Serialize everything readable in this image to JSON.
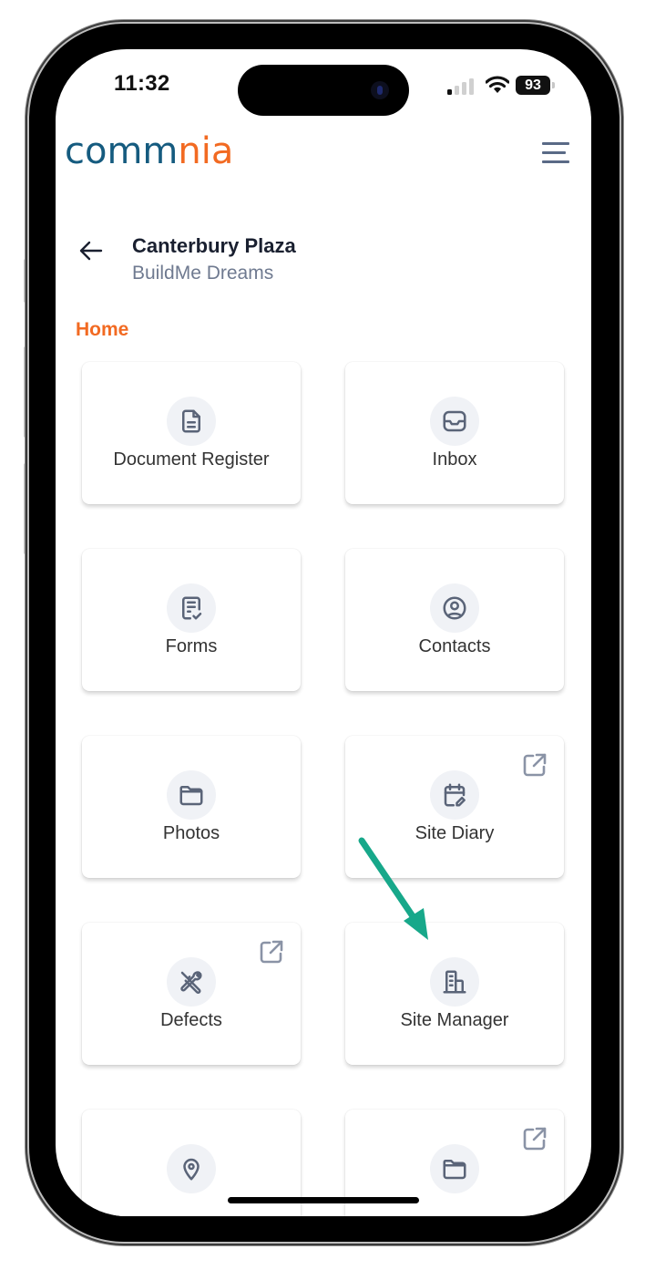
{
  "status_bar": {
    "time": "11:32",
    "battery": "93",
    "signal_bars_active": 1,
    "signal_bars_total": 4,
    "icons": [
      "signal-icon",
      "wifi-icon",
      "battery-icon"
    ]
  },
  "header": {
    "logo": {
      "part1": "comm",
      "part2": "nia",
      "brand_blue": "#155b7f",
      "brand_orange": "#f26a22"
    },
    "menu_icon": "hamburger-menu-icon"
  },
  "project": {
    "title": "Canterbury Plaza",
    "subtitle": "BuildMe Dreams",
    "back_icon": "arrow-left-icon"
  },
  "section": {
    "label": "Home",
    "accent_color": "#f26a22"
  },
  "tiles": [
    {
      "label": "Document Register",
      "icon": "document-icon",
      "external": false
    },
    {
      "label": "Inbox",
      "icon": "inbox-icon",
      "external": false
    },
    {
      "label": "Forms",
      "icon": "form-check-icon",
      "external": false
    },
    {
      "label": "Contacts",
      "icon": "user-circle-icon",
      "external": false
    },
    {
      "label": "Photos",
      "icon": "folder-icon",
      "external": false
    },
    {
      "label": "Site Diary",
      "icon": "calendar-edit-icon",
      "external": true
    },
    {
      "label": "Defects",
      "icon": "tools-icon",
      "external": true
    },
    {
      "label": "Site Manager",
      "icon": "building-icon",
      "external": false
    },
    {
      "label": "",
      "icon": "map-pin-icon",
      "external": false
    },
    {
      "label": "",
      "icon": "folder-icon",
      "external": true
    }
  ],
  "annotation": {
    "type": "arrow",
    "color": "#17a88a",
    "points_to": "Site Manager"
  },
  "colors": {
    "icon": "#5a6478",
    "icon_bg": "#f0f2f6",
    "external_icon": "#8a93a6"
  }
}
